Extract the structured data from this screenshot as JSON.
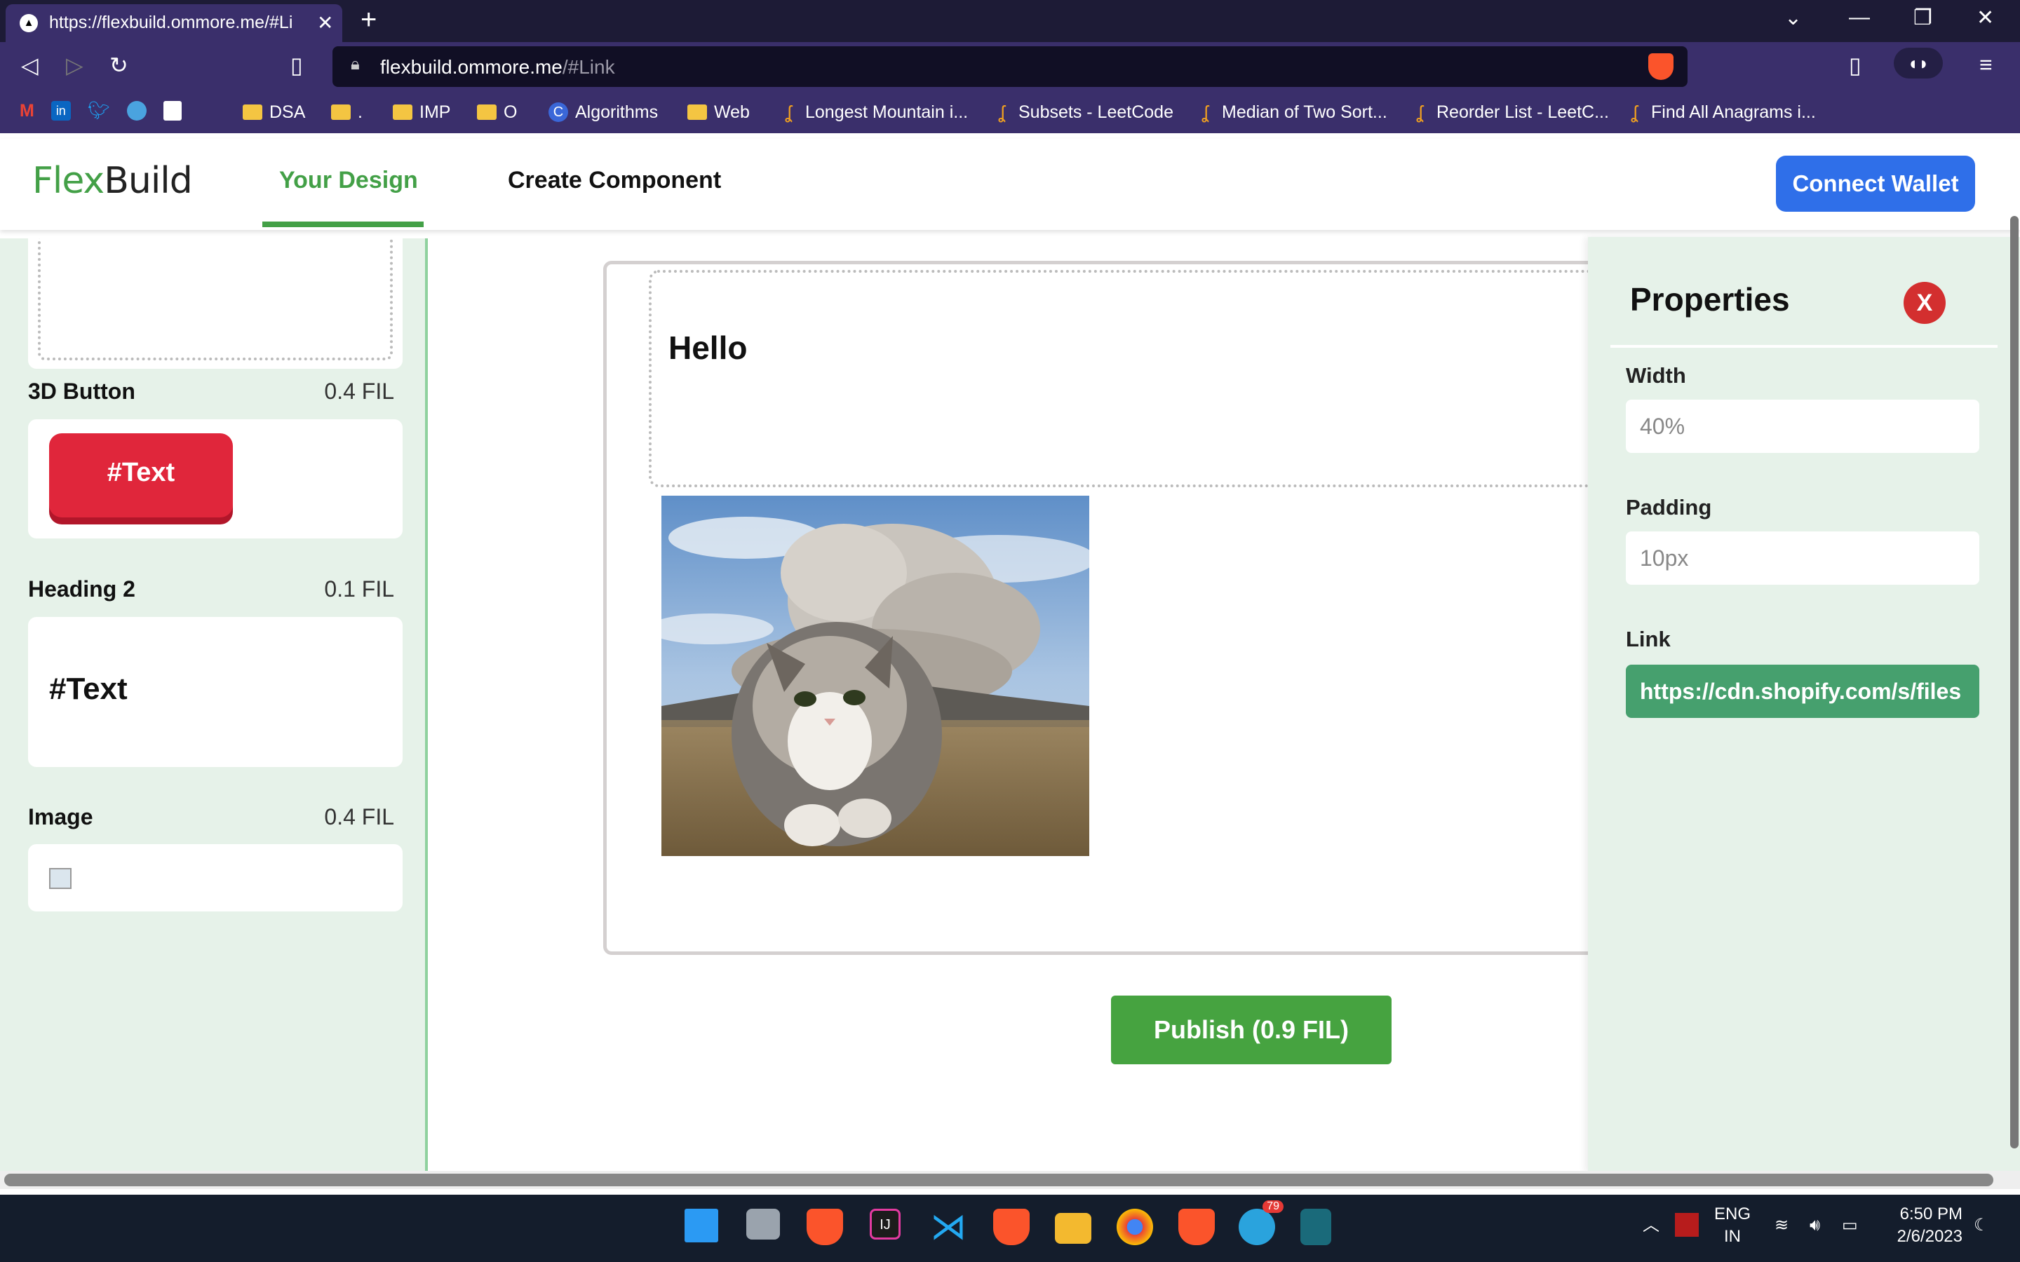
{
  "browser": {
    "tab_title": "https://flexbuild.ommore.me/#Li",
    "url_host": "flexbuild.ommore.me",
    "url_hash": "/#Link",
    "bookmarks": [
      "DSA",
      ".",
      "IMP",
      "O",
      "Algorithms",
      "Web",
      "Longest Mountain i...",
      "Subsets - LeetCode",
      "Median of Two Sort...",
      "Reorder List - LeetC...",
      "Find All Anagrams i..."
    ]
  },
  "header": {
    "logo_part1": "Flex",
    "logo_part2": "Build",
    "tab_your_design": "Your Design",
    "tab_create": "Create Component",
    "connect_label": "Connect Wallet"
  },
  "components": [
    {
      "name": "3D Button",
      "price": "0.4 FIL",
      "preview": "#Text"
    },
    {
      "name": "Heading 2",
      "price": "0.1 FIL",
      "preview": "#Text"
    },
    {
      "name": "Image",
      "price": "0.4 FIL"
    }
  ],
  "canvas": {
    "heading_text": "Hello",
    "publish_label": "Publish (0.9 FIL)"
  },
  "properties": {
    "title": "Properties",
    "close_label": "X",
    "width_label": "Width",
    "width_value": "40%",
    "padding_label": "Padding",
    "padding_value": "10px",
    "link_label": "Link",
    "link_value": "https://cdn.shopify.com/s/files"
  },
  "taskbar": {
    "lang": "ENG",
    "region": "IN",
    "time": "6:50 PM",
    "date": "2/6/2023",
    "telegram_badge": "79"
  },
  "colors": {
    "accent_green": "#43a047",
    "connect_blue": "#2f6fe9",
    "button_red": "#e0263b",
    "publish_green": "#46a340"
  }
}
